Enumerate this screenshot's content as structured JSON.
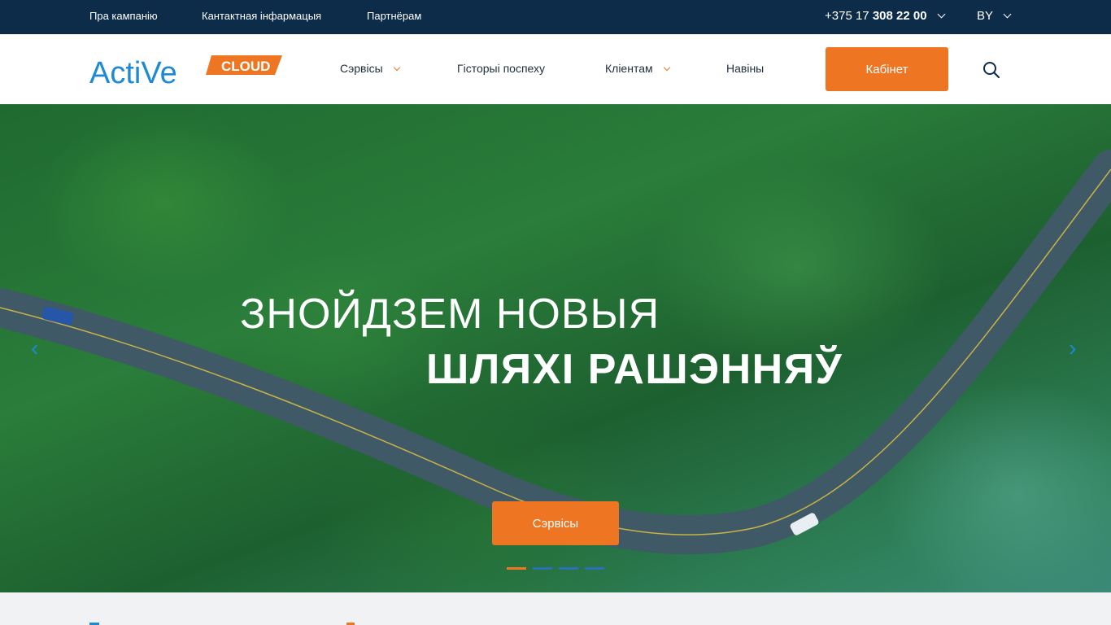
{
  "topbar": {
    "links": [
      "Пра кампанію",
      "Кантактная інфармацыя",
      "Партнёрам"
    ],
    "phone_prefix": "+375 17",
    "phone_main": "308 22 00",
    "language": "BY"
  },
  "header": {
    "logo_text": "ActiVe",
    "logo_badge": "CLOUD",
    "nav": {
      "services": "Сэрвісы",
      "success": "Гісторыі поспеху",
      "clients": "Кліентам",
      "news": "Навіны"
    },
    "cabinet_label": "Кабінет"
  },
  "hero": {
    "title_line1": "ЗНОЙДЗЕМ НОВЫЯ",
    "title_line2": "ШЛЯХІ РАШЭННЯЎ",
    "button_label": "Сэрвісы",
    "arrow_prev": "‹",
    "arrow_next": "›",
    "slide_count": 4,
    "active_slide": 1
  },
  "colors": {
    "topbar_bg": "#0d2c4a",
    "accent_orange": "#ee7623",
    "accent_blue": "#1d8ad6"
  }
}
